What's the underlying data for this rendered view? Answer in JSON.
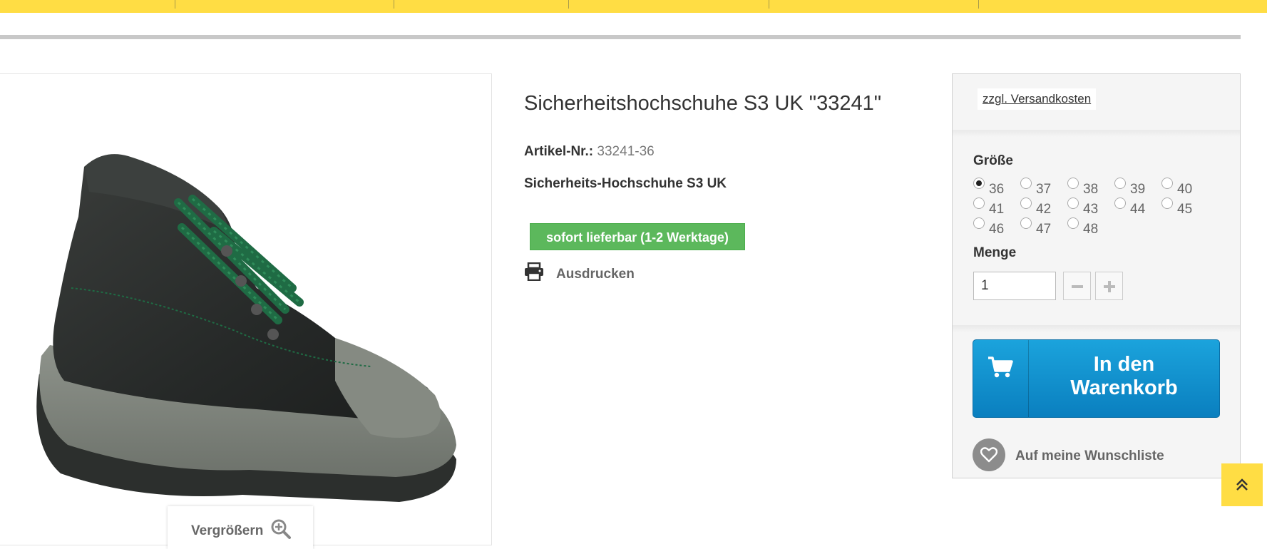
{
  "colors": {
    "brand_yellow": "#ffdd44",
    "stock_green": "#5cb85c",
    "cart_blue": "#0a7fbf"
  },
  "product": {
    "title": "Sicherheitshochschuhe S3 UK \"33241\"",
    "article_label": "Artikel-Nr.:",
    "article_number": "33241-36",
    "subtitle": "Sicherheits-Hochschuhe S3 UK",
    "availability": "sofort lieferbar (1-2 Werktage)",
    "print_label": "Ausdrucken",
    "zoom_label": "Vergrößern",
    "image_icon": "safety-boot-image"
  },
  "buybox": {
    "shipping_link": "zzgl. Versandkosten",
    "size_label": "Größe",
    "sizes": [
      "36",
      "37",
      "38",
      "39",
      "40",
      "41",
      "42",
      "43",
      "44",
      "45",
      "46",
      "47",
      "48"
    ],
    "selected_size": "36",
    "quantity_label": "Menge",
    "quantity_value": "1",
    "cart_label_line1": "In den",
    "cart_label_line2": "Warenkorb",
    "wishlist_label": "Auf meine Wunschliste"
  },
  "icons": {
    "print": "printer-icon",
    "zoom": "zoom-in-icon",
    "cart": "shopping-cart-icon",
    "wishlist": "heart-icon",
    "minus": "minus-icon",
    "plus": "plus-icon",
    "to_top": "double-chevron-up-icon"
  }
}
